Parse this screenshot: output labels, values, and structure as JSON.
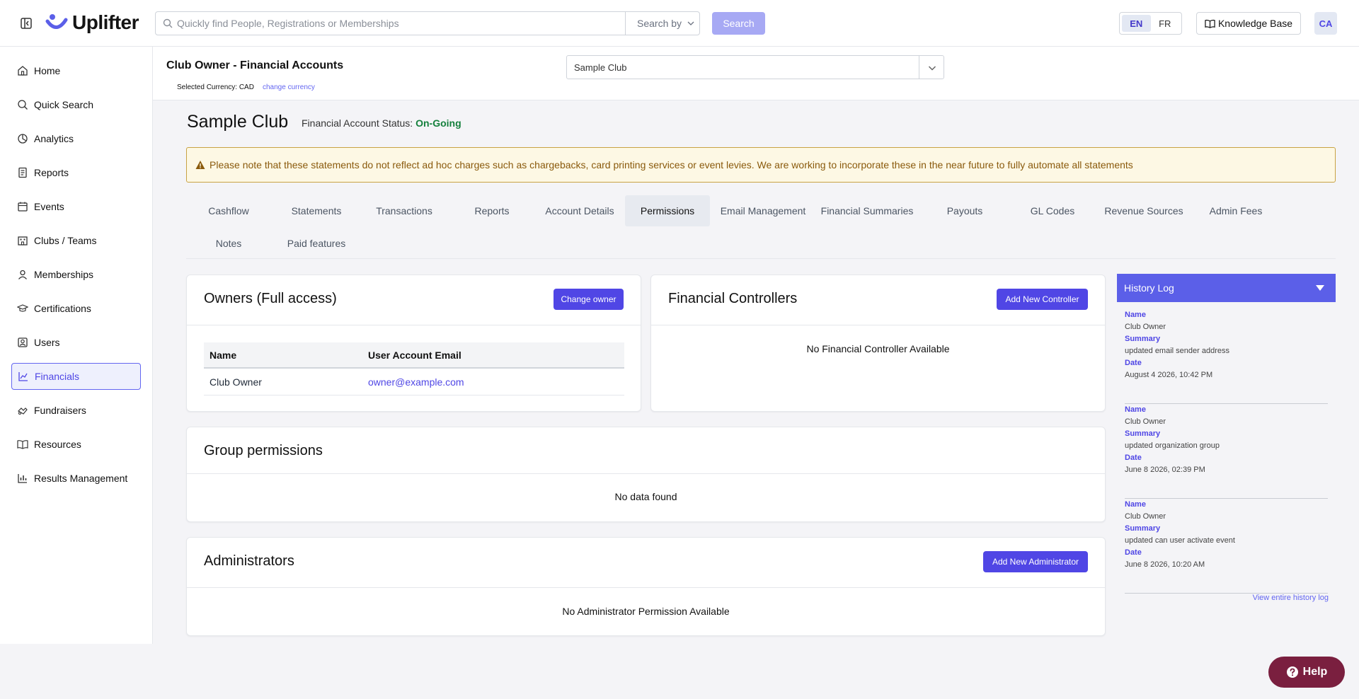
{
  "brand": {
    "name": "Uplifter",
    "accent": "#5046e5"
  },
  "search": {
    "placeholder": "Quickly find People, Registrations or Memberships",
    "search_by": "Search by",
    "button": "Search"
  },
  "header_right": {
    "lang_en": "EN",
    "lang_fr": "FR",
    "knowledge_base": "Knowledge Base",
    "avatar": "CA"
  },
  "sidebar": {
    "items": [
      {
        "label": "Home",
        "icon": "home-icon"
      },
      {
        "label": "Quick Search",
        "icon": "search-icon"
      },
      {
        "label": "Analytics",
        "icon": "analytics-icon"
      },
      {
        "label": "Reports",
        "icon": "reports-icon"
      },
      {
        "label": "Events",
        "icon": "calendar-icon"
      },
      {
        "label": "Clubs / Teams",
        "icon": "building-icon"
      },
      {
        "label": "Memberships",
        "icon": "user-badge-icon"
      },
      {
        "label": "Certifications",
        "icon": "graduation-cap-icon"
      },
      {
        "label": "Users",
        "icon": "user-icon"
      },
      {
        "label": "Financials",
        "icon": "chart-icon"
      },
      {
        "label": "Fundraisers",
        "icon": "handshake-icon"
      },
      {
        "label": "Resources",
        "icon": "book-icon"
      },
      {
        "label": "Results Management",
        "icon": "bar-chart-icon"
      }
    ]
  },
  "page_header": {
    "title": "Club Owner - Financial Accounts",
    "currency": "Selected Currency: CAD",
    "change_currency": "change currency",
    "club_select": "Sample Club"
  },
  "main": {
    "club_name": "Sample Club",
    "status_label": "Financial Account Status:",
    "status_value": "On-Going",
    "alert": "Please note that these statements do not reflect ad hoc charges such as chargebacks, card printing services or event levies. We are working to incorporate these in the near future to fully automate all statements",
    "tabs": [
      "Cashflow",
      "Statements",
      "Transactions",
      "Reports",
      "Account Details",
      "Permissions",
      "Email Management",
      "Financial Summaries",
      "Payouts",
      "GL Codes",
      "Revenue Sources",
      "Admin Fees",
      "Notes",
      "Paid features"
    ],
    "active_tab": "Permissions"
  },
  "owners": {
    "title": "Owners (Full access)",
    "button": "Change owner",
    "columns": [
      "Name",
      "User Account Email"
    ],
    "rows": [
      {
        "name": "Club Owner",
        "email": "owner@example.com"
      }
    ]
  },
  "controllers": {
    "title": "Financial Controllers",
    "button": "Add New Controller",
    "empty": "No Financial Controller Available"
  },
  "groups": {
    "title": "Group permissions",
    "empty": "No data found"
  },
  "admins": {
    "title": "Administrators",
    "button": "Add New Administrator",
    "empty": "No Administrator Permission Available"
  },
  "history": {
    "title": "History Log",
    "labels": {
      "name": "Name",
      "summary": "Summary",
      "date": "Date"
    },
    "entries": [
      {
        "name": "Club Owner",
        "summary": "updated email sender address",
        "date": "August 4 2026, 10:42 PM"
      },
      {
        "name": "Club Owner",
        "summary": "updated organization group",
        "date": "June 8 2026, 02:39 PM"
      },
      {
        "name": "Club Owner",
        "summary": "updated can user activate event",
        "date": "June 8 2026, 10:20 AM"
      }
    ],
    "link": "View entire history log"
  },
  "help": {
    "label": "Help"
  }
}
